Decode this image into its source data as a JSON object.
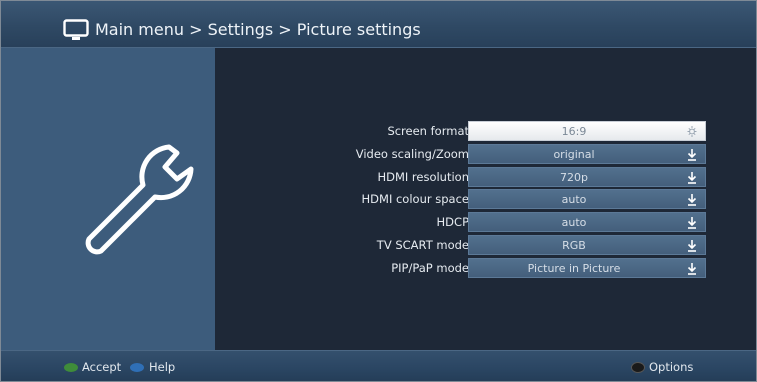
{
  "header": {
    "breadcrumb": "Main menu > Settings > Picture settings"
  },
  "settings": [
    {
      "label": "Screen format",
      "value": "16:9",
      "selected": true
    },
    {
      "label": "Video scaling/Zoom",
      "value": "original",
      "selected": false
    },
    {
      "label": "HDMI resolution",
      "value": "720p",
      "selected": false
    },
    {
      "label": "HDMI colour space",
      "value": "auto",
      "selected": false
    },
    {
      "label": "HDCP",
      "value": "auto",
      "selected": false
    },
    {
      "label": "TV SCART mode",
      "value": "RGB",
      "selected": false
    },
    {
      "label": "PIP/PaP mode",
      "value": "Picture in Picture",
      "selected": false
    }
  ],
  "footer": {
    "accept_label": "Accept",
    "help_label": "Help",
    "options_label": "Options"
  },
  "colors": {
    "accept_button": "#3f8c3a",
    "help_button": "#2f6fb6",
    "sidebar": "#3d5c7c",
    "background": "#1e2837"
  },
  "icons": {
    "header": "tv-icon",
    "sidebar": "wrench-icon",
    "selected_row": "sun-icon",
    "dropdown": "arrow-down-icon"
  }
}
